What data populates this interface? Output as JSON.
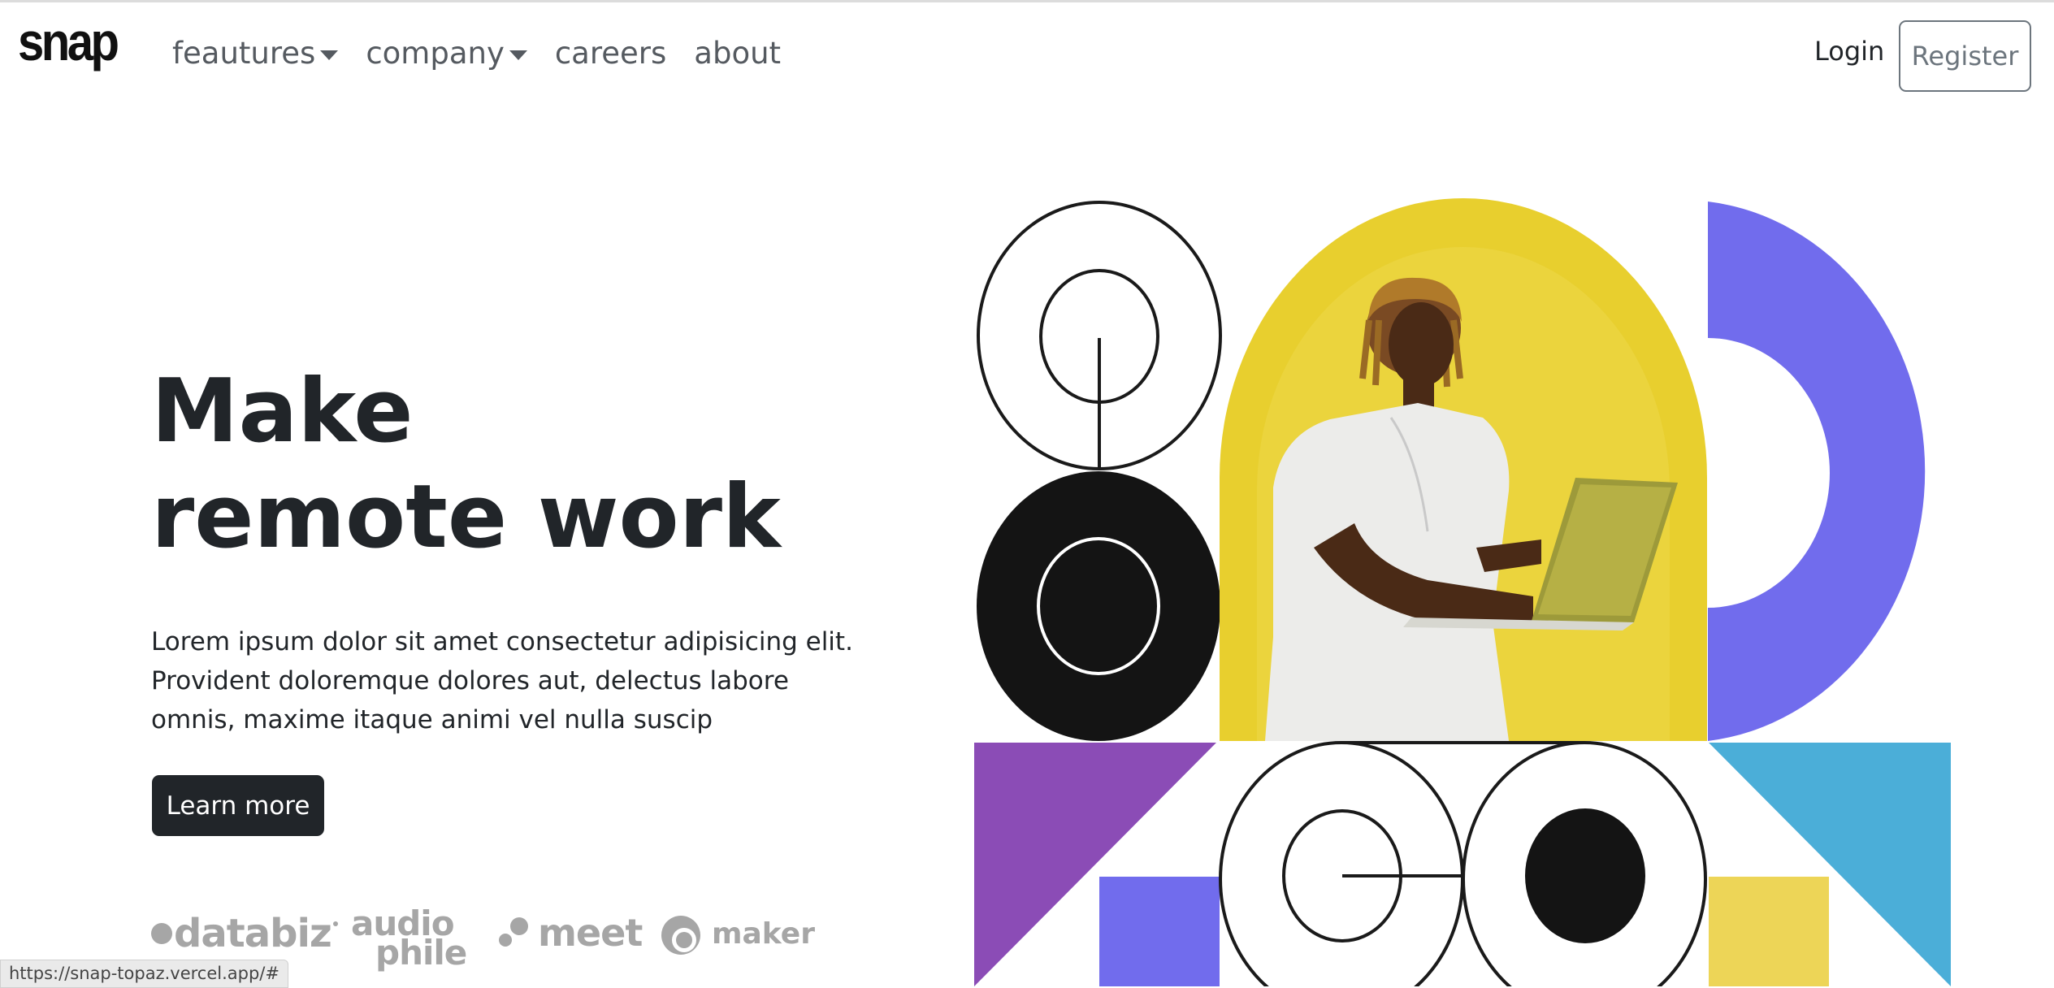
{
  "brand": {
    "logo": "snap"
  },
  "nav": {
    "items": [
      {
        "label": "feautures",
        "dropdown": true
      },
      {
        "label": "company",
        "dropdown": true
      },
      {
        "label": "careers",
        "dropdown": false
      },
      {
        "label": "about",
        "dropdown": false
      }
    ]
  },
  "auth": {
    "login": "Login",
    "register": "Register"
  },
  "hero": {
    "title_lines": [
      "Make",
      "remote work"
    ],
    "text_lines": [
      "Lorem ipsum dolor sit amet consectetur adipisicing elit.",
      "Provident doloremque dolores aut, delectus labore",
      "omnis, maxime itaque animi vel nulla suscip"
    ],
    "cta": "Learn more"
  },
  "clients": {
    "databiz": "databiz",
    "audiophile_top": "audio",
    "audiophile_bottom": "phile",
    "meet": "meet",
    "maker": "maker"
  },
  "status_bar": {
    "url": "https://snap-topaz.vercel.app/#"
  },
  "colors": {
    "dark": "#212529",
    "yellow": "#e8cf2e",
    "violet": "#716ced",
    "purple": "#8b4cb6",
    "sky": "#4baed8",
    "pale_yellow": "#edd557",
    "muted_gray": "#a6a6a6"
  }
}
